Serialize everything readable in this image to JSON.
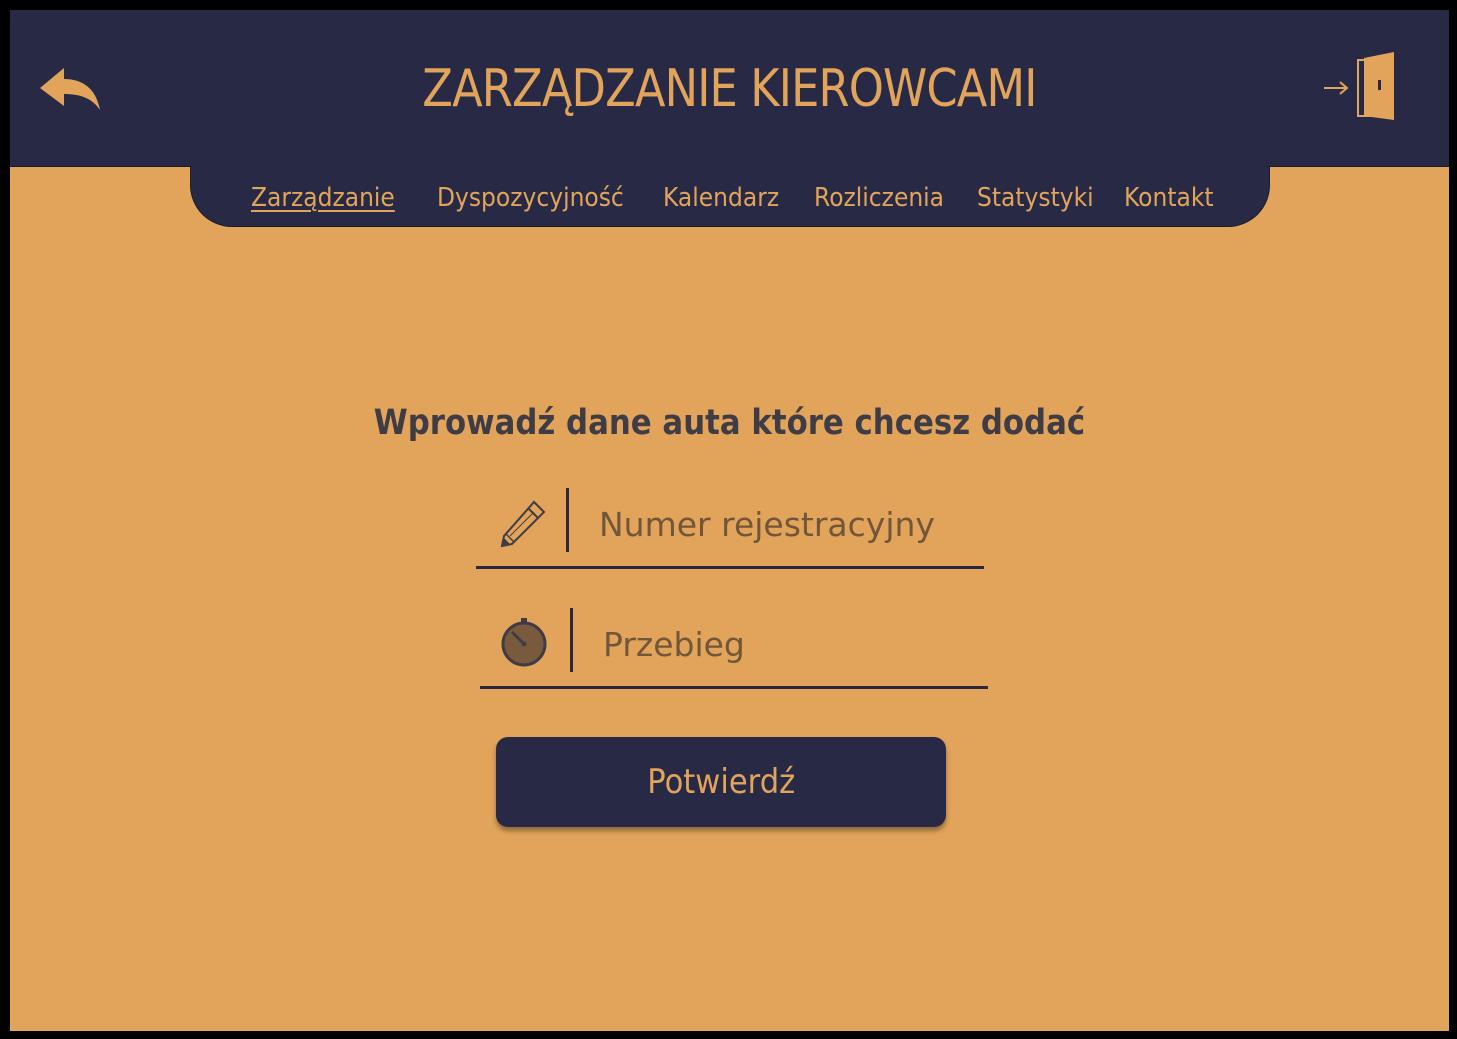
{
  "header": {
    "title": "ZARZĄDZANIE KIEROWCAMI",
    "back_icon": "reply-arrow-icon",
    "logout_icon": "door-exit-icon"
  },
  "nav": {
    "items": [
      {
        "label": "Zarządzanie",
        "active": true
      },
      {
        "label": "Dyspozycyjność",
        "active": false
      },
      {
        "label": "Kalendarz",
        "active": false
      },
      {
        "label": "Rozliczenia",
        "active": false
      },
      {
        "label": "Statystyki",
        "active": false
      },
      {
        "label": "Kontakt",
        "active": false
      }
    ]
  },
  "form": {
    "heading": "Wprowadź dane auta które chcesz dodać",
    "fields": [
      {
        "icon": "pencil-icon",
        "placeholder": "Numer rejestracyjny",
        "value": ""
      },
      {
        "icon": "stopwatch-icon",
        "placeholder": "Przebieg",
        "value": ""
      }
    ],
    "submit_label": "Potwierdź"
  },
  "colors": {
    "background": "#E1A45A",
    "header": "#282A45",
    "accent": "#E1A45A",
    "text_dark": "#3F3C45"
  }
}
